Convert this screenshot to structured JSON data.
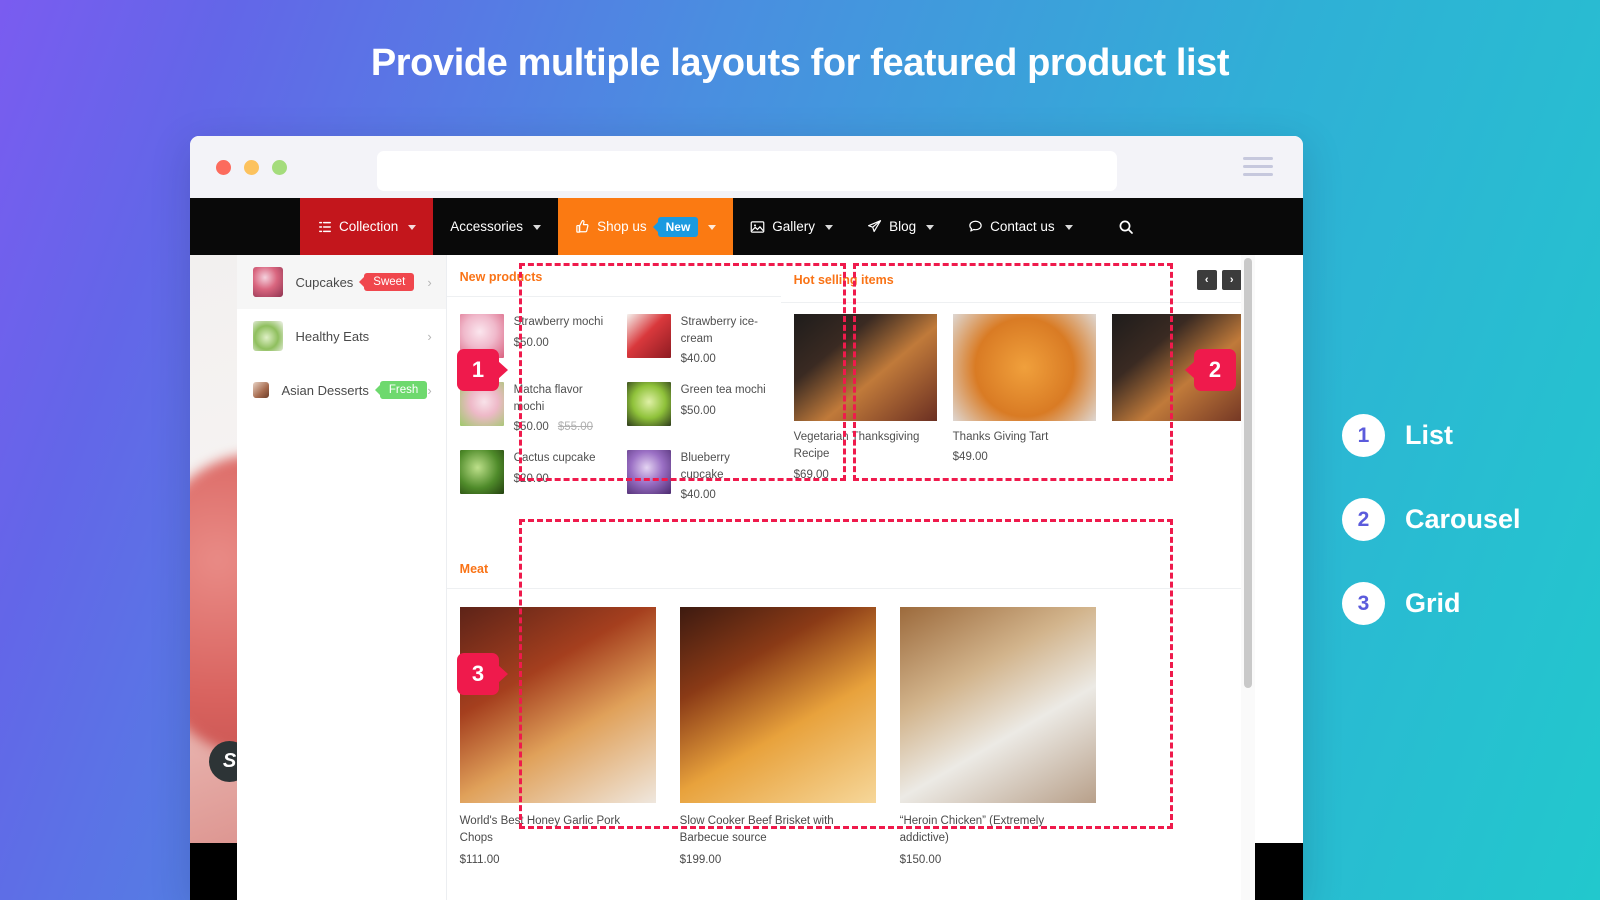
{
  "headline": "Provide multiple layouts for featured product list",
  "browser": {
    "dots": [
      "close",
      "minimize",
      "maximize"
    ],
    "url_value": "",
    "url_placeholder": "",
    "menu_icon": "hamburger-icon"
  },
  "nav": {
    "items": [
      {
        "label": "Collection",
        "icon": "list-icon",
        "style": "red",
        "caret": true,
        "tag": null
      },
      {
        "label": "Accessories",
        "icon": null,
        "style": "plain",
        "caret": true,
        "tag": null
      },
      {
        "label": "Shop us",
        "icon": "thumbs-up-icon",
        "style": "orange",
        "caret": true,
        "tag": "New"
      },
      {
        "label": "Gallery",
        "icon": "image-icon",
        "style": "plain",
        "caret": true,
        "tag": null
      },
      {
        "label": "Blog",
        "icon": "paper-plane-icon",
        "style": "plain",
        "caret": true,
        "tag": null
      },
      {
        "label": "Contact us",
        "icon": "chat-bubble-icon",
        "style": "plain",
        "caret": true,
        "tag": null
      }
    ],
    "search_icon": "search-icon"
  },
  "sidebar": {
    "categories": [
      {
        "label": "Cupcakes",
        "pill": "Sweet",
        "pill_color": "#f0474d",
        "active": true,
        "chevron": "›"
      },
      {
        "label": "Healthy Eats",
        "pill": null,
        "pill_color": null,
        "active": false,
        "chevron": "›"
      },
      {
        "label": "Asian Desserts",
        "pill": "Fresh",
        "pill_color": "#6ed96e",
        "active": false,
        "chevron": "›"
      }
    ]
  },
  "panels": {
    "list": {
      "title": "New products",
      "products": [
        {
          "name": "Strawberry mochi",
          "price": "$50.00",
          "old_price": null
        },
        {
          "name": "Strawberry ice-cream",
          "price": "$40.00",
          "old_price": null
        },
        {
          "name": "Matcha flavor mochi",
          "price": "$50.00",
          "old_price": "$55.00"
        },
        {
          "name": "Green tea mochi",
          "price": "$50.00",
          "old_price": null
        },
        {
          "name": "Cactus cupcake",
          "price": "$20.00",
          "old_price": null
        },
        {
          "name": "Blueberry cupcake",
          "price": "$40.00",
          "old_price": null
        }
      ]
    },
    "carousel": {
      "title": "Hot selling items",
      "prev_label": "‹",
      "next_label": "›",
      "products": [
        {
          "name": "Vegetarian Thanksgiving Recipe",
          "price": "$69.00"
        },
        {
          "name": "Thanks Giving Tart",
          "price": "$49.00"
        }
      ]
    },
    "grid": {
      "title": "Meat",
      "products": [
        {
          "name": "World's Best Honey Garlic Pork Chops",
          "price": "$111.00"
        },
        {
          "name": "Slow Cooker Beef Brisket with Barbecue source",
          "price": "$199.00"
        },
        {
          "name": "“Heroin Chicken” (Extremely addictive)",
          "price": "$150.00"
        }
      ]
    }
  },
  "annotations": {
    "badges": [
      {
        "number": "1"
      },
      {
        "number": "2"
      },
      {
        "number": "3"
      }
    ],
    "accent_color": "#ef1a4c"
  },
  "legend": {
    "items": [
      {
        "number": "1",
        "label": "List"
      },
      {
        "number": "2",
        "label": "Carousel"
      },
      {
        "number": "3",
        "label": "Grid"
      }
    ]
  }
}
